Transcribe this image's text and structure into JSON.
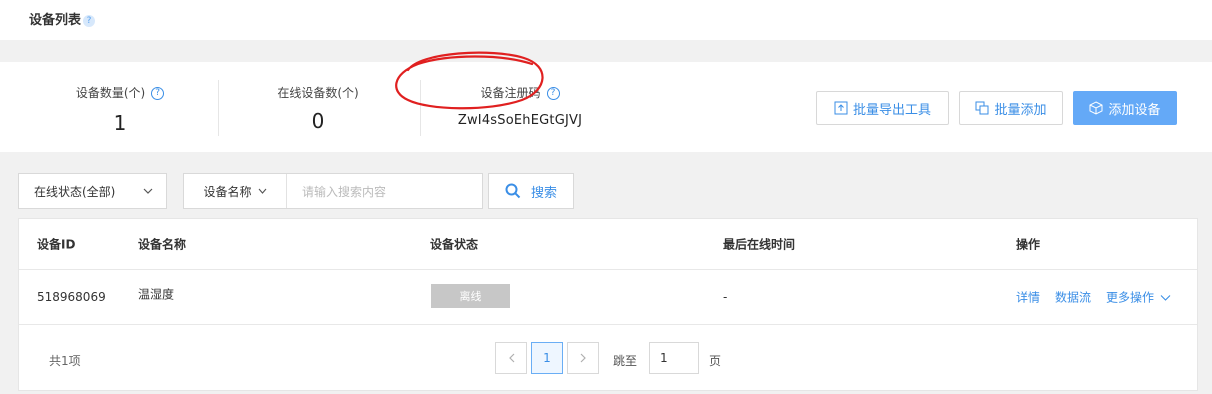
{
  "header": {
    "title": "设备列表",
    "help": "?"
  },
  "summary": {
    "device_count_label": "设备数量(个)",
    "device_count_value": "1",
    "online_count_label": "在线设备数(个)",
    "online_count_value": "0",
    "reg_code_label": "设备注册码",
    "reg_code_value": "ZwI4sSoEhEGtGJVJ",
    "help": "?"
  },
  "actions": {
    "batch_export": "批量导出工具",
    "batch_add": "批量添加",
    "add_device": "添加设备"
  },
  "filters": {
    "status_select": "在线状态(全部)",
    "search_type": "设备名称",
    "search_placeholder": "请输入搜索内容",
    "search_button": "搜索"
  },
  "table": {
    "columns": [
      "设备ID",
      "设备名称",
      "设备状态",
      "最后在线时间",
      "操作"
    ],
    "rows": [
      {
        "id": "518968069",
        "name": "温湿度",
        "status": "离线",
        "last_online": "-",
        "actions": {
          "detail": "详情",
          "stream": "数据流",
          "more": "更多操作"
        }
      }
    ]
  },
  "pagination": {
    "total": "共1项",
    "current": "1",
    "jump_label": "跳至",
    "jump_value": "1",
    "page_unit": "页"
  },
  "colors": {
    "accent": "#3a8ee6",
    "primary_button": "#64a9f7",
    "offline_badge": "#c7c7c7",
    "annotation": "#e02020"
  }
}
